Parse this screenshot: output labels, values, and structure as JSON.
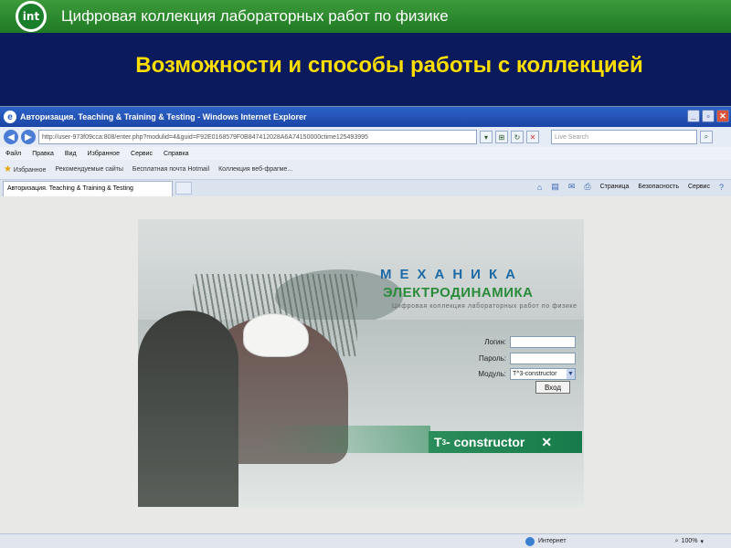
{
  "slide": {
    "logo_text": "int",
    "subtitle": "Цифровая коллекция лабораторных работ по физике",
    "title": "Возможности и способы работы с коллекцией"
  },
  "browser": {
    "window_title": "Авторизация. Teaching & Training & Testing - Windows Internet Explorer",
    "url_host": "http://user-973f09cca",
    "url_rest": ":808/enter.php?modulid=4&guid=F92E0168579F0B847412028A6A74150000ctime125493995",
    "search_placeholder": "Live Search",
    "menu": [
      "Файл",
      "Правка",
      "Вид",
      "Избранное",
      "Сервис",
      "Справка"
    ],
    "favorites": {
      "label": "Избранное",
      "items": [
        "Рекомендуемые сайты",
        "Бесплатная почта Hotmail",
        "Коллекция веб-фрагме..."
      ]
    },
    "tab_label": "Авторизация. Teaching & Training & Testing",
    "commands": [
      "Страница",
      "Безопасность",
      "Сервис"
    ],
    "status": {
      "zone": "Интернет",
      "zoom": "100%"
    }
  },
  "login": {
    "logo_mech": "МЕХАНИКА",
    "logo_elec": "ЭЛЕКТРОДИНАМИКА",
    "logo_sub": "Цифровая коллекция лабораторных работ по физике",
    "login_label": "Логин:",
    "password_label": "Пароль:",
    "module_label": "Модуль:",
    "module_value": "T^3-constructor",
    "submit": "Вход",
    "banner_t": "T",
    "banner_sup": "3",
    "banner_text": " - constructor"
  }
}
